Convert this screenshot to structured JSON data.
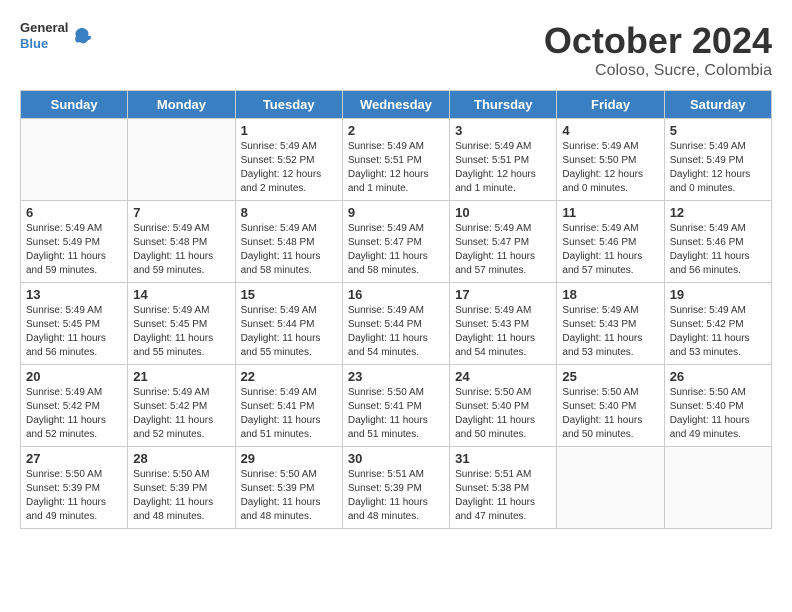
{
  "header": {
    "logo_line1": "General",
    "logo_line2": "Blue",
    "month": "October 2024",
    "location": "Coloso, Sucre, Colombia"
  },
  "weekdays": [
    "Sunday",
    "Monday",
    "Tuesday",
    "Wednesday",
    "Thursday",
    "Friday",
    "Saturday"
  ],
  "weeks": [
    [
      {
        "day": "",
        "sunrise": "",
        "sunset": "",
        "daylight": "",
        "empty": true
      },
      {
        "day": "",
        "sunrise": "",
        "sunset": "",
        "daylight": "",
        "empty": true
      },
      {
        "day": "1",
        "sunrise": "Sunrise: 5:49 AM",
        "sunset": "Sunset: 5:52 PM",
        "daylight": "Daylight: 12 hours and 2 minutes.",
        "empty": false
      },
      {
        "day": "2",
        "sunrise": "Sunrise: 5:49 AM",
        "sunset": "Sunset: 5:51 PM",
        "daylight": "Daylight: 12 hours and 1 minute.",
        "empty": false
      },
      {
        "day": "3",
        "sunrise": "Sunrise: 5:49 AM",
        "sunset": "Sunset: 5:51 PM",
        "daylight": "Daylight: 12 hours and 1 minute.",
        "empty": false
      },
      {
        "day": "4",
        "sunrise": "Sunrise: 5:49 AM",
        "sunset": "Sunset: 5:50 PM",
        "daylight": "Daylight: 12 hours and 0 minutes.",
        "empty": false
      },
      {
        "day": "5",
        "sunrise": "Sunrise: 5:49 AM",
        "sunset": "Sunset: 5:49 PM",
        "daylight": "Daylight: 12 hours and 0 minutes.",
        "empty": false
      }
    ],
    [
      {
        "day": "6",
        "sunrise": "Sunrise: 5:49 AM",
        "sunset": "Sunset: 5:49 PM",
        "daylight": "Daylight: 11 hours and 59 minutes.",
        "empty": false
      },
      {
        "day": "7",
        "sunrise": "Sunrise: 5:49 AM",
        "sunset": "Sunset: 5:48 PM",
        "daylight": "Daylight: 11 hours and 59 minutes.",
        "empty": false
      },
      {
        "day": "8",
        "sunrise": "Sunrise: 5:49 AM",
        "sunset": "Sunset: 5:48 PM",
        "daylight": "Daylight: 11 hours and 58 minutes.",
        "empty": false
      },
      {
        "day": "9",
        "sunrise": "Sunrise: 5:49 AM",
        "sunset": "Sunset: 5:47 PM",
        "daylight": "Daylight: 11 hours and 58 minutes.",
        "empty": false
      },
      {
        "day": "10",
        "sunrise": "Sunrise: 5:49 AM",
        "sunset": "Sunset: 5:47 PM",
        "daylight": "Daylight: 11 hours and 57 minutes.",
        "empty": false
      },
      {
        "day": "11",
        "sunrise": "Sunrise: 5:49 AM",
        "sunset": "Sunset: 5:46 PM",
        "daylight": "Daylight: 11 hours and 57 minutes.",
        "empty": false
      },
      {
        "day": "12",
        "sunrise": "Sunrise: 5:49 AM",
        "sunset": "Sunset: 5:46 PM",
        "daylight": "Daylight: 11 hours and 56 minutes.",
        "empty": false
      }
    ],
    [
      {
        "day": "13",
        "sunrise": "Sunrise: 5:49 AM",
        "sunset": "Sunset: 5:45 PM",
        "daylight": "Daylight: 11 hours and 56 minutes.",
        "empty": false
      },
      {
        "day": "14",
        "sunrise": "Sunrise: 5:49 AM",
        "sunset": "Sunset: 5:45 PM",
        "daylight": "Daylight: 11 hours and 55 minutes.",
        "empty": false
      },
      {
        "day": "15",
        "sunrise": "Sunrise: 5:49 AM",
        "sunset": "Sunset: 5:44 PM",
        "daylight": "Daylight: 11 hours and 55 minutes.",
        "empty": false
      },
      {
        "day": "16",
        "sunrise": "Sunrise: 5:49 AM",
        "sunset": "Sunset: 5:44 PM",
        "daylight": "Daylight: 11 hours and 54 minutes.",
        "empty": false
      },
      {
        "day": "17",
        "sunrise": "Sunrise: 5:49 AM",
        "sunset": "Sunset: 5:43 PM",
        "daylight": "Daylight: 11 hours and 54 minutes.",
        "empty": false
      },
      {
        "day": "18",
        "sunrise": "Sunrise: 5:49 AM",
        "sunset": "Sunset: 5:43 PM",
        "daylight": "Daylight: 11 hours and 53 minutes.",
        "empty": false
      },
      {
        "day": "19",
        "sunrise": "Sunrise: 5:49 AM",
        "sunset": "Sunset: 5:42 PM",
        "daylight": "Daylight: 11 hours and 53 minutes.",
        "empty": false
      }
    ],
    [
      {
        "day": "20",
        "sunrise": "Sunrise: 5:49 AM",
        "sunset": "Sunset: 5:42 PM",
        "daylight": "Daylight: 11 hours and 52 minutes.",
        "empty": false
      },
      {
        "day": "21",
        "sunrise": "Sunrise: 5:49 AM",
        "sunset": "Sunset: 5:42 PM",
        "daylight": "Daylight: 11 hours and 52 minutes.",
        "empty": false
      },
      {
        "day": "22",
        "sunrise": "Sunrise: 5:49 AM",
        "sunset": "Sunset: 5:41 PM",
        "daylight": "Daylight: 11 hours and 51 minutes.",
        "empty": false
      },
      {
        "day": "23",
        "sunrise": "Sunrise: 5:50 AM",
        "sunset": "Sunset: 5:41 PM",
        "daylight": "Daylight: 11 hours and 51 minutes.",
        "empty": false
      },
      {
        "day": "24",
        "sunrise": "Sunrise: 5:50 AM",
        "sunset": "Sunset: 5:40 PM",
        "daylight": "Daylight: 11 hours and 50 minutes.",
        "empty": false
      },
      {
        "day": "25",
        "sunrise": "Sunrise: 5:50 AM",
        "sunset": "Sunset: 5:40 PM",
        "daylight": "Daylight: 11 hours and 50 minutes.",
        "empty": false
      },
      {
        "day": "26",
        "sunrise": "Sunrise: 5:50 AM",
        "sunset": "Sunset: 5:40 PM",
        "daylight": "Daylight: 11 hours and 49 minutes.",
        "empty": false
      }
    ],
    [
      {
        "day": "27",
        "sunrise": "Sunrise: 5:50 AM",
        "sunset": "Sunset: 5:39 PM",
        "daylight": "Daylight: 11 hours and 49 minutes.",
        "empty": false
      },
      {
        "day": "28",
        "sunrise": "Sunrise: 5:50 AM",
        "sunset": "Sunset: 5:39 PM",
        "daylight": "Daylight: 11 hours and 48 minutes.",
        "empty": false
      },
      {
        "day": "29",
        "sunrise": "Sunrise: 5:50 AM",
        "sunset": "Sunset: 5:39 PM",
        "daylight": "Daylight: 11 hours and 48 minutes.",
        "empty": false
      },
      {
        "day": "30",
        "sunrise": "Sunrise: 5:51 AM",
        "sunset": "Sunset: 5:39 PM",
        "daylight": "Daylight: 11 hours and 48 minutes.",
        "empty": false
      },
      {
        "day": "31",
        "sunrise": "Sunrise: 5:51 AM",
        "sunset": "Sunset: 5:38 PM",
        "daylight": "Daylight: 11 hours and 47 minutes.",
        "empty": false
      },
      {
        "day": "",
        "sunrise": "",
        "sunset": "",
        "daylight": "",
        "empty": true
      },
      {
        "day": "",
        "sunrise": "",
        "sunset": "",
        "daylight": "",
        "empty": true
      }
    ]
  ]
}
